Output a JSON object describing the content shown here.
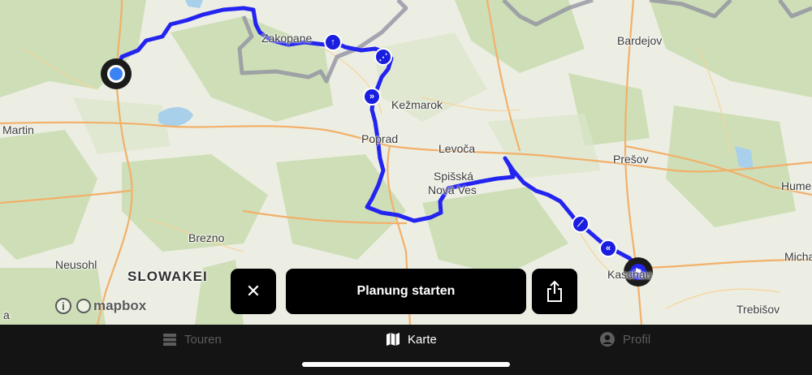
{
  "map": {
    "cities": [
      {
        "id": "zakopane",
        "name": "Zakopane"
      },
      {
        "id": "bardejov",
        "name": "Bardejov"
      },
      {
        "id": "kezmarok",
        "name": "Kežmarok"
      },
      {
        "id": "martin",
        "name": "Martin"
      },
      {
        "id": "poprad",
        "name": "Poprad"
      },
      {
        "id": "levoca",
        "name": "Levoča"
      },
      {
        "id": "presov",
        "name": "Prešov"
      },
      {
        "id": "spisska1",
        "name": "Spišská"
      },
      {
        "id": "spisska2",
        "name": "Nová Ves"
      },
      {
        "id": "humenne",
        "name": "Hume"
      },
      {
        "id": "brezno",
        "name": "Brezno"
      },
      {
        "id": "neusohl",
        "name": "Neusohl"
      },
      {
        "id": "kaschau",
        "name": "Kaschau"
      },
      {
        "id": "michalovce",
        "name": "Micha"
      },
      {
        "id": "trebisov",
        "name": "Trebišov"
      },
      {
        "id": "edge_a",
        "name": "a"
      }
    ],
    "country_label": "SLOWAKEI",
    "attribution": {
      "info": "i",
      "logo_text": "mapbox"
    },
    "colors": {
      "route": "#2424f0",
      "border": "#8a8a9a",
      "road": "#f2b06a",
      "water": "#a8d0ea",
      "forest": "#c9dcb0"
    }
  },
  "actions": {
    "close_label": "✕",
    "start_label": "Planung starten",
    "share_icon": "share-icon"
  },
  "tabs": [
    {
      "id": "touren",
      "label": "Touren",
      "icon": "list-icon",
      "active": false
    },
    {
      "id": "karte",
      "label": "Karte",
      "icon": "map-icon",
      "active": true
    },
    {
      "id": "profil",
      "label": "Profil",
      "icon": "user-icon",
      "active": false
    }
  ]
}
